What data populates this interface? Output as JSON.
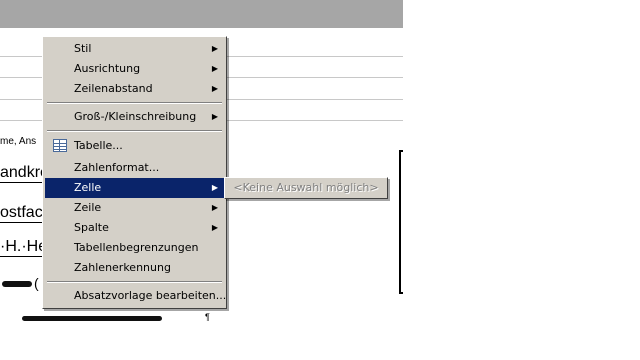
{
  "document": {
    "lines": [
      "me, Ans",
      "andkre",
      "ostfac",
      "·H.·He",
      "(",
      "¶"
    ]
  },
  "context_menu": {
    "items": [
      {
        "label": "Stil",
        "has_submenu": true
      },
      {
        "label": "Ausrichtung",
        "has_submenu": true
      },
      {
        "label": "Zeilenabstand",
        "has_submenu": true
      },
      {
        "label": "Groß-/Kleinschreibung",
        "has_submenu": true
      },
      {
        "label": "Tabelle...",
        "has_submenu": false,
        "icon": "table-icon"
      },
      {
        "label": "Zahlenformat...",
        "has_submenu": false
      },
      {
        "label": "Zelle",
        "has_submenu": true,
        "active": true
      },
      {
        "label": "Zeile",
        "has_submenu": true
      },
      {
        "label": "Spalte",
        "has_submenu": true
      },
      {
        "label": "Tabellenbegrenzungen",
        "has_submenu": false
      },
      {
        "label": "Zahlenerkennung",
        "has_submenu": false
      },
      {
        "label": "Absatzvorlage bearbeiten...",
        "has_submenu": false
      }
    ],
    "arrow_glyph": "▶"
  },
  "submenu": {
    "disabled_item": "<Keine Auswahl möglich>"
  },
  "colors": {
    "menu_bg": "#d4d0c8",
    "highlight": "#0a246a",
    "toolbar_gray": "#a6a6a6"
  }
}
